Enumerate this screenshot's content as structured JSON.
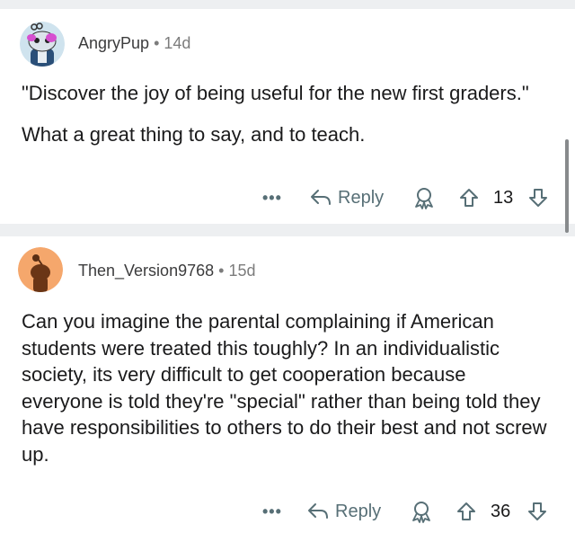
{
  "comments": [
    {
      "username": "AngryPup",
      "separator": "•",
      "age": "14d",
      "paragraphs": [
        "\"Discover the joy of being useful for the new first graders.\"",
        "What a great thing to say, and to teach."
      ],
      "more_label": "•••",
      "reply_label": "Reply",
      "vote_count": "13"
    },
    {
      "username": "Then_Version9768",
      "separator": "•",
      "age": "15d",
      "paragraphs": [
        "Can you imagine the parental complaining if American students were treated this toughly? In an individualistic society, its very difficult to get cooperation because everyone is told they're \"special\" rather than being told they have responsibilities to others to do their best and not screw up."
      ],
      "more_label": "•••",
      "reply_label": "Reply",
      "vote_count": "36"
    }
  ],
  "colors": {
    "action_grey": "#576f76",
    "divider": "#edeff1",
    "avatar2_bg": "#f5a76c"
  }
}
